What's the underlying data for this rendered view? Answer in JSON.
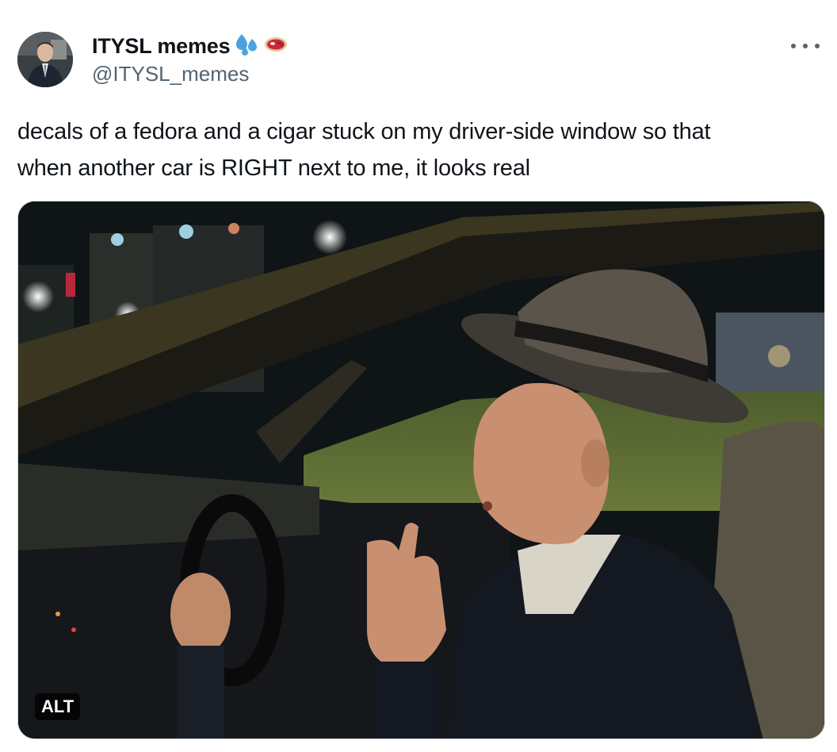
{
  "tweet": {
    "display_name": "ITYSL memes",
    "handle": "@ITYSL_memes",
    "name_emojis": [
      "sweat-droplets-icon",
      "steak-icon"
    ],
    "text_line1": "decals of a fedora and a cigar stuck on my driver-side window so that",
    "text_line2": "when another car is RIGHT next to me, it looks real",
    "more_icon": "more-dots-icon",
    "media": {
      "description_icon": "photo-of-man-in-fedora-driving-car-at-night",
      "alt_label": "ALT"
    }
  },
  "colors": {
    "text_primary": "#0f1419",
    "text_secondary": "#536471",
    "border": "#cfd9de",
    "emoji_blue": "#4aa3df",
    "emoji_red": "#c8283a"
  }
}
